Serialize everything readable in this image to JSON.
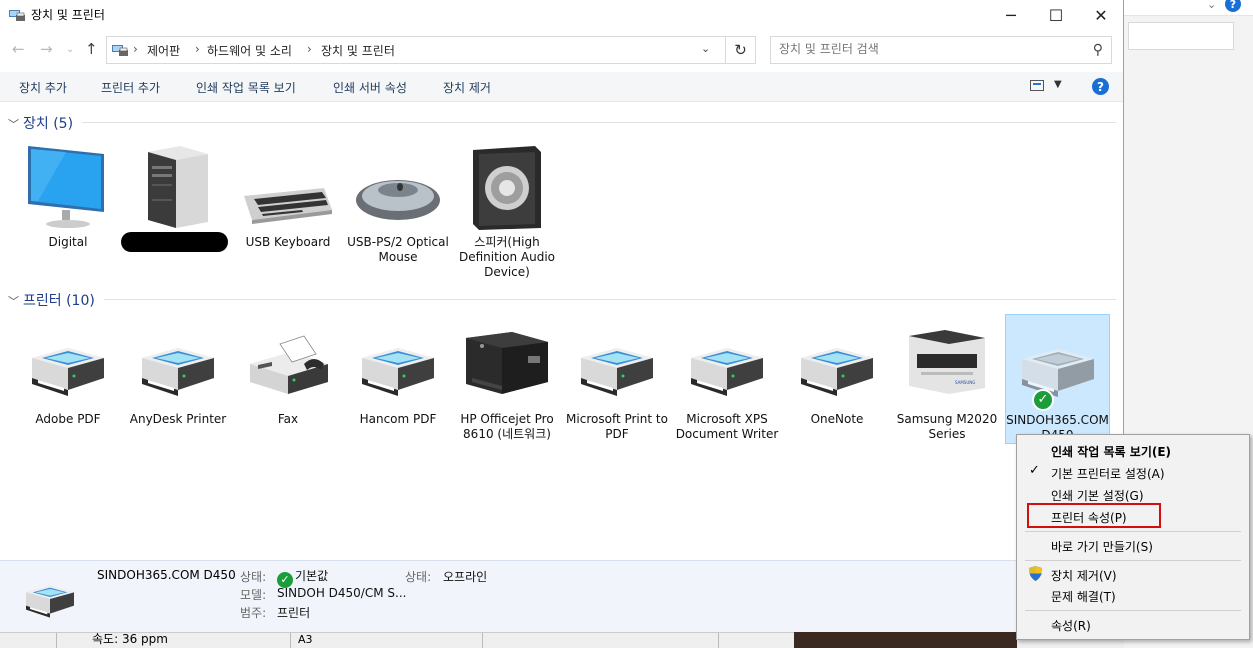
{
  "window": {
    "title": "장치 및 프린터",
    "controls": {
      "minimize": "─",
      "maximize": "☐",
      "close": "✕"
    }
  },
  "address": {
    "crumbs": [
      "제어판",
      "하드웨어 및 소리",
      "장치 및 프린터"
    ],
    "separator": "›",
    "search_placeholder": "장치 및 프린터 검색"
  },
  "commands": [
    "장치 추가",
    "프린터 추가",
    "인쇄 작업 목록 보기",
    "인쇄 서버 속성",
    "장치 제거"
  ],
  "devices_group": {
    "title": "장치 (5)"
  },
  "devices": [
    {
      "name": "Digital",
      "icon": "monitor-icon"
    },
    {
      "name": "",
      "icon": "computer-tower-icon"
    },
    {
      "name": "USB Keyboard",
      "icon": "keyboard-icon"
    },
    {
      "name": "USB-PS/2 Optical Mouse",
      "icon": "mouse-icon"
    },
    {
      "name": "스피커(High Definition Audio Device)",
      "icon": "speaker-icon"
    }
  ],
  "printers_group": {
    "title": "프린터 (10)"
  },
  "printers": [
    {
      "name": "Adobe PDF",
      "icon": "printer-icon"
    },
    {
      "name": "AnyDesk Printer",
      "icon": "printer-icon"
    },
    {
      "name": "Fax",
      "icon": "fax-icon"
    },
    {
      "name": "Hancom PDF",
      "icon": "printer-icon"
    },
    {
      "name": "HP Officejet Pro 8610 (네트워크)",
      "icon": "inkjet-printer-icon"
    },
    {
      "name": "Microsoft Print to PDF",
      "icon": "printer-icon"
    },
    {
      "name": "Microsoft XPS Document Writer",
      "icon": "printer-icon"
    },
    {
      "name": "OneNote",
      "icon": "printer-icon"
    },
    {
      "name": "Samsung M2020 Series",
      "icon": "laser-printer-icon"
    },
    {
      "name": "SINDOH365.COM D450",
      "icon": "printer-icon",
      "selected": true,
      "default": true
    }
  ],
  "details": {
    "name": "SINDOH365.COM D450",
    "status_label": "상태:",
    "status_value": "기본값",
    "status2_label": "상태:",
    "status2_value": "오프라인",
    "model_label": "모델:",
    "model_value": "SINDOH D450/CM S...",
    "category_label": "범주:",
    "category_value": "프린터"
  },
  "context_menu": {
    "items": [
      {
        "label": "인쇄 작업 목록 보기(E)",
        "bold": true
      },
      {
        "label": "기본 프린터로 설정(A)",
        "checked": true
      },
      {
        "label": "인쇄 기본 설정(G)"
      },
      {
        "label": "프린터 속성(P)",
        "highlighted": true
      },
      {
        "label": "바로 가기 만들기(S)"
      },
      {
        "label": "장치 제거(V)",
        "shield": true
      },
      {
        "label": "문제 해결(T)"
      },
      {
        "label": "속성(R)"
      }
    ]
  },
  "background": {
    "speed_text": "속도: 36 ppm",
    "paper_text": "A3",
    "help_glyph": "?"
  },
  "colors": {
    "accent": "#1a6fd6",
    "group_title": "#1e3e8a",
    "selection": "#cce8ff",
    "highlight_box": "#d20f0f",
    "ok_green": "#1b9e3a"
  }
}
